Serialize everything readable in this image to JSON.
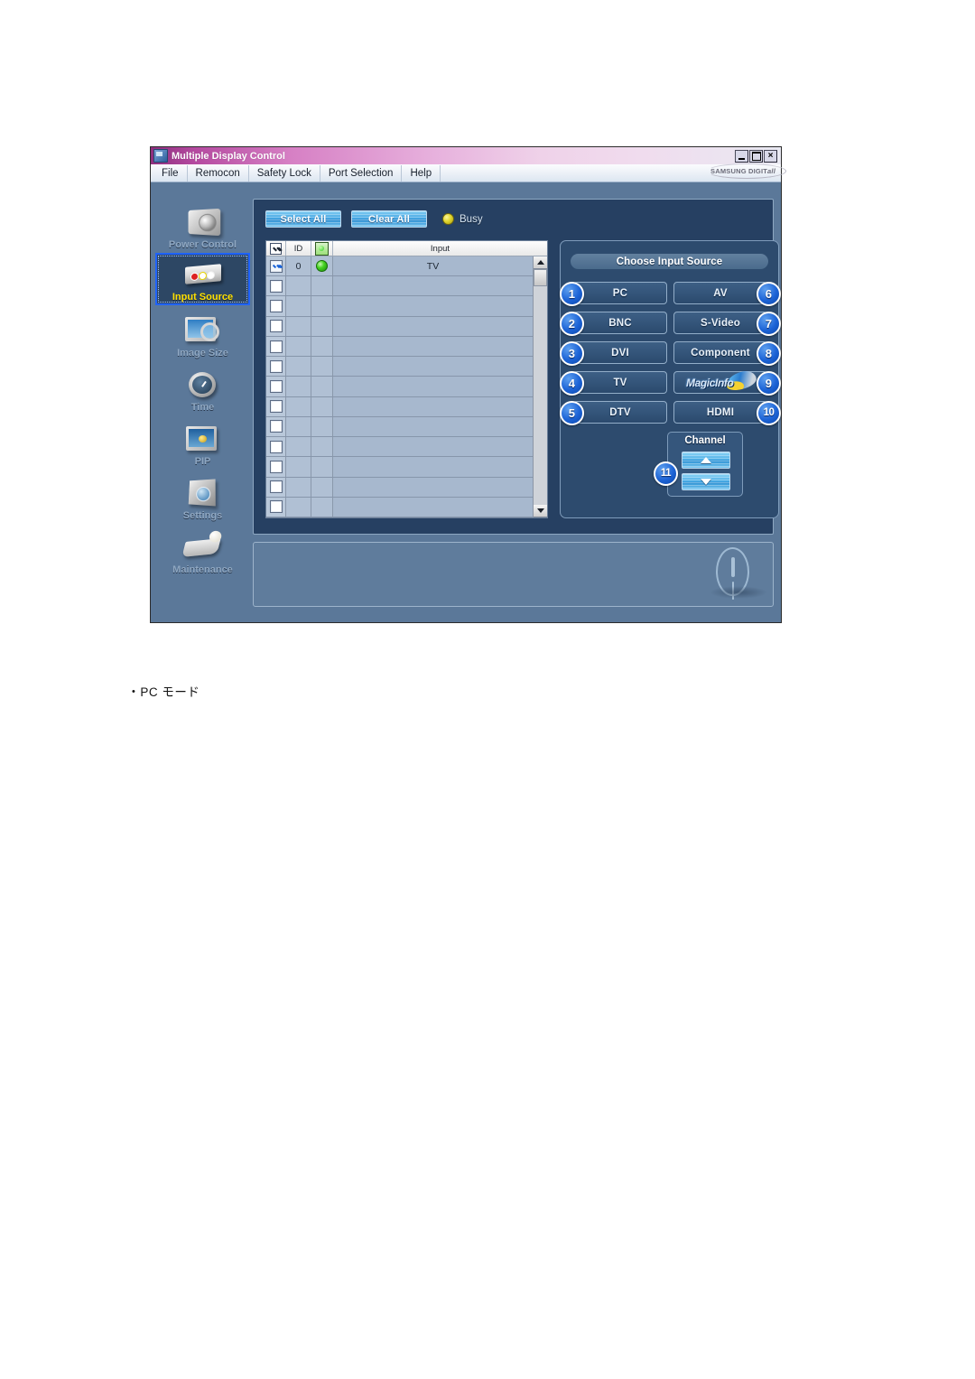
{
  "window": {
    "title": "Multiple Display Control",
    "title_icon": "app-icon",
    "buttons": {
      "minimize": "minimize",
      "maximize": "maximize",
      "close": "×"
    },
    "brand": "SAMSUNG DIGIT",
    "brand_suffix": "all"
  },
  "menu": {
    "items": [
      {
        "label": "File"
      },
      {
        "label": "Remocon"
      },
      {
        "label": "Safety Lock"
      },
      {
        "label": "Port Selection"
      },
      {
        "label": "Help"
      }
    ]
  },
  "sidebar": {
    "items": [
      {
        "label": "Power Control",
        "icon": "power-control-icon",
        "active": false
      },
      {
        "label": "Input Source",
        "icon": "input-source-icon",
        "active": true
      },
      {
        "label": "Image Size",
        "icon": "image-size-icon",
        "active": false
      },
      {
        "label": "Time",
        "icon": "time-icon",
        "active": false
      },
      {
        "label": "PIP",
        "icon": "pip-icon",
        "active": false
      },
      {
        "label": "Settings",
        "icon": "settings-icon",
        "active": false
      },
      {
        "label": "Maintenance",
        "icon": "maintenance-icon",
        "active": false
      }
    ]
  },
  "toolbar": {
    "select_all": "Select All",
    "clear_all": "Clear All",
    "busy_label": "Busy",
    "busy_color": "#e0d52e"
  },
  "table": {
    "headers": {
      "check": "check-all",
      "id": "ID",
      "status": "power-status",
      "input": "Input"
    },
    "rows": [
      {
        "checked": true,
        "id": "0",
        "status": "on",
        "input": "TV"
      },
      {
        "checked": false,
        "id": "",
        "status": "none",
        "input": ""
      },
      {
        "checked": false,
        "id": "",
        "status": "none",
        "input": ""
      },
      {
        "checked": false,
        "id": "",
        "status": "none",
        "input": ""
      },
      {
        "checked": false,
        "id": "",
        "status": "none",
        "input": ""
      },
      {
        "checked": false,
        "id": "",
        "status": "none",
        "input": ""
      },
      {
        "checked": false,
        "id": "",
        "status": "none",
        "input": ""
      },
      {
        "checked": false,
        "id": "",
        "status": "none",
        "input": ""
      },
      {
        "checked": false,
        "id": "",
        "status": "none",
        "input": ""
      },
      {
        "checked": false,
        "id": "",
        "status": "none",
        "input": ""
      },
      {
        "checked": false,
        "id": "",
        "status": "none",
        "input": ""
      },
      {
        "checked": false,
        "id": "",
        "status": "none",
        "input": ""
      },
      {
        "checked": false,
        "id": "",
        "status": "none",
        "input": ""
      }
    ],
    "status_on_color": "#46d321"
  },
  "source_panel": {
    "title": "Choose Input Source",
    "buttons_left": [
      {
        "badge": "1",
        "label": "PC"
      },
      {
        "badge": "2",
        "label": "BNC"
      },
      {
        "badge": "3",
        "label": "DVI"
      },
      {
        "badge": "4",
        "label": "TV"
      },
      {
        "badge": "5",
        "label": "DTV"
      }
    ],
    "buttons_right": [
      {
        "badge": "6",
        "label": "AV"
      },
      {
        "badge": "7",
        "label": "S-Video"
      },
      {
        "badge": "8",
        "label": "Component"
      },
      {
        "badge": "9",
        "label": "MagicInfo"
      },
      {
        "badge": "10",
        "label": "HDMI"
      }
    ],
    "channel": {
      "badge": "11",
      "label": "Channel",
      "up_icon": "chevron-up-icon",
      "down_icon": "chevron-down-icon"
    },
    "badge_color": "#1c63d6"
  },
  "status_bar": {
    "message": "",
    "icon": "exclamation-icon"
  },
  "caption": {
    "bullet": "•",
    "text": "PC モード"
  }
}
